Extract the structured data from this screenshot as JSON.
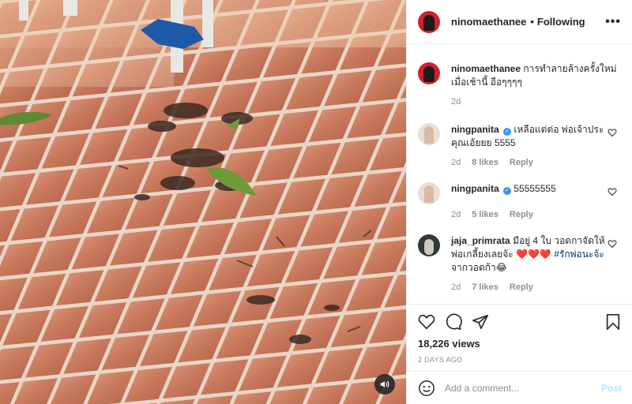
{
  "post": {
    "username": "ninomaethanee",
    "follow_status": "Following",
    "more_icon": "more-options-icon",
    "caption": "การทำลายล้างครั้งใหม่เมื่อเช้านี้ อือๆๆๆๆ",
    "caption_time": "2d",
    "views": "18,226 views",
    "date": "2 DAYS AGO"
  },
  "comments": [
    {
      "username": "ningpanita",
      "verified": true,
      "text": "เหลือแต่ต่อ พ่อเจ้าประคุณเอ้ยยย 5555",
      "time": "2d",
      "likes": "8 likes",
      "reply": "Reply"
    },
    {
      "username": "ningpanita",
      "verified": true,
      "text": "55555555",
      "time": "2d",
      "likes": "5 likes",
      "reply": "Reply"
    },
    {
      "username": "jaja_primrata",
      "verified": false,
      "text": "มีอยู่ 4 ใบ วอดกาจัดให้พ่อเกลี้ยงเลยจ้ะ",
      "hearts": "❤️❤️❤️",
      "tag": "#รักพ่อนะจ้ะ",
      "text_after": "จากวอดก้า😂",
      "time": "2d",
      "likes": "7 likes",
      "reply": "Reply"
    }
  ],
  "verified_badge": "✓",
  "add_comment": {
    "placeholder": "Add a comment...",
    "post_label": "Post"
  },
  "dot": "•",
  "colors": {
    "link": "#00376b",
    "verified": "#3897f0",
    "post_disabled": "#b2dffc",
    "muted": "#8e8e8e"
  },
  "icons": [
    "heart-icon",
    "comment-icon",
    "share-icon",
    "bookmark-icon",
    "emoji-icon",
    "sound-icon"
  ]
}
